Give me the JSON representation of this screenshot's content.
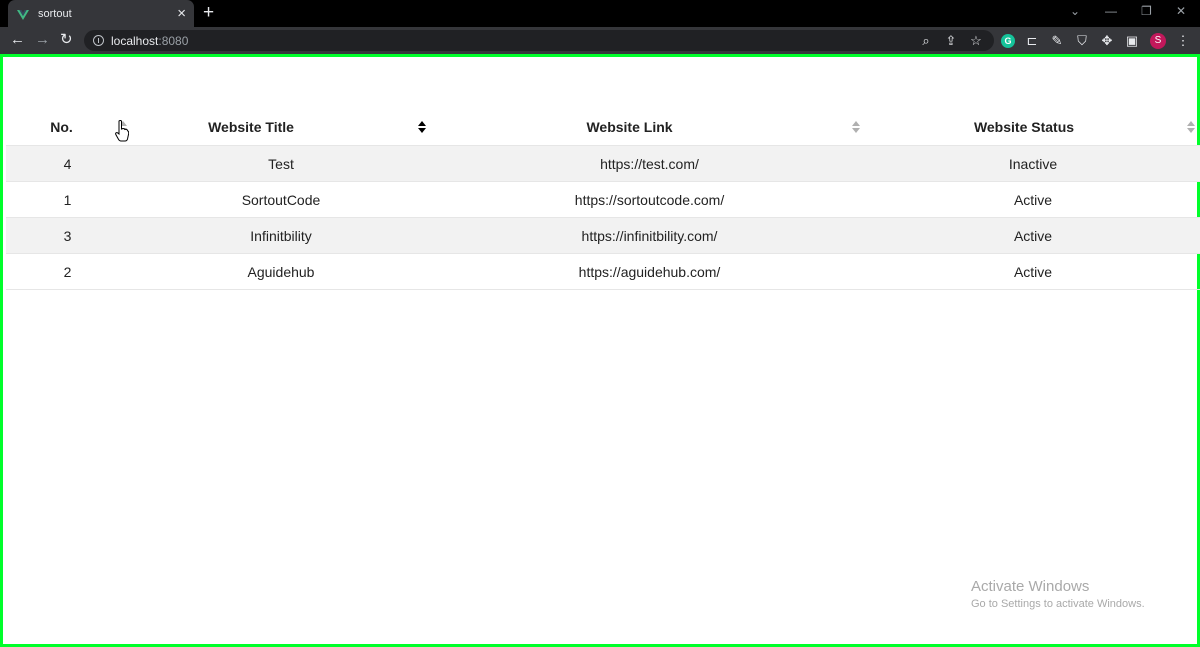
{
  "browser": {
    "tab_title": "sortout",
    "new_tab_label": "+",
    "url_host": "localhost",
    "url_port": ":8080",
    "profile_initial": "S",
    "icons": [
      "back-icon",
      "forward-icon",
      "reload-icon",
      "zoom-icon",
      "share-icon",
      "bookmark-star-icon",
      "grammarly-icon",
      "extension-icon",
      "pen-icon",
      "shield-icon",
      "puzzle-icon",
      "sidepanel-icon",
      "menu-icon"
    ]
  },
  "table": {
    "headers": {
      "no": "No.",
      "title": "Website Title",
      "link": "Website Link",
      "status": "Website Status"
    },
    "rows": [
      {
        "no": "4",
        "title": "Test",
        "link": "https://test.com/",
        "status": "Inactive"
      },
      {
        "no": "1",
        "title": "SortoutCode",
        "link": "https://sortoutcode.com/",
        "status": "Active"
      },
      {
        "no": "3",
        "title": "Infinitbility",
        "link": "https://infinitbility.com/",
        "status": "Active"
      },
      {
        "no": "2",
        "title": "Aguidehub",
        "link": "https://aguidehub.com/",
        "status": "Active"
      }
    ]
  },
  "watermark": {
    "title": "Activate Windows",
    "subtitle": "Go to Settings to activate Windows."
  },
  "colors": {
    "frame_border": "#00ff2a",
    "stripe": "#f2f2f2"
  }
}
